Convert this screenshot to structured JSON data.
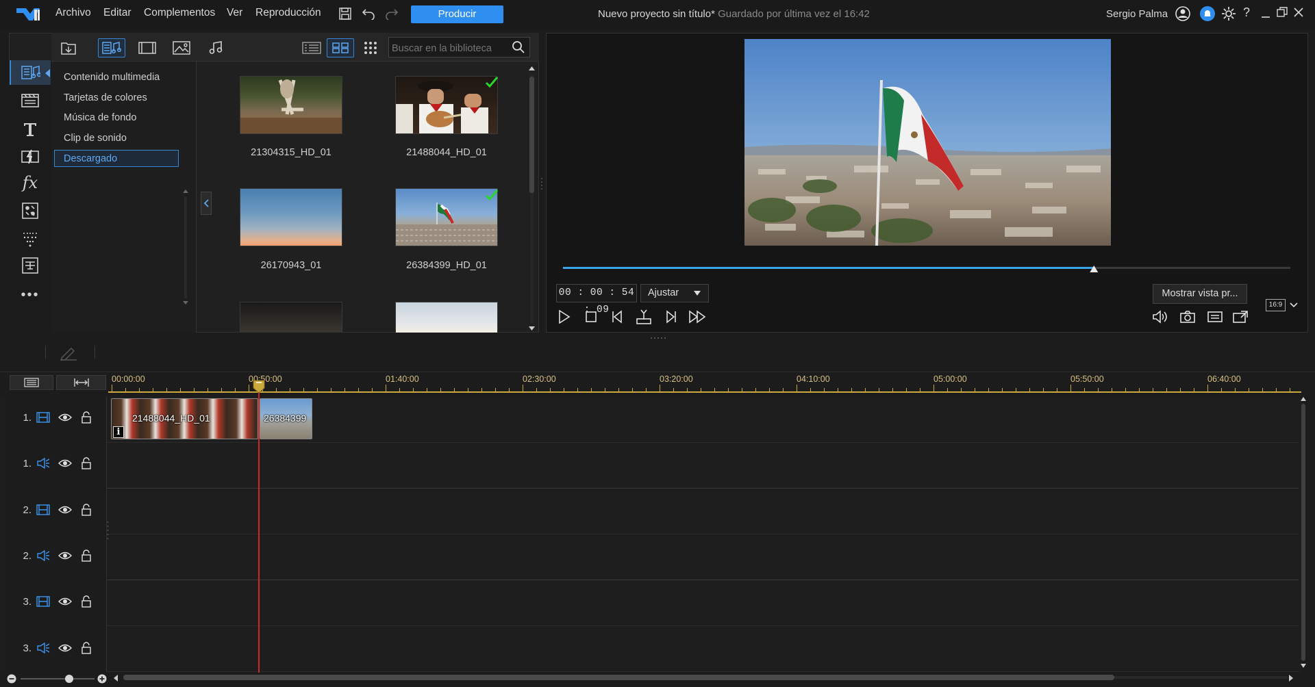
{
  "menu": {
    "items": [
      "Archivo",
      "Editar",
      "Complementos",
      "Ver",
      "Reproducción"
    ]
  },
  "produce_label": "Producir",
  "project": {
    "title": "Nuevo proyecto sin título*",
    "saved": " Guardado por última vez el 16:42"
  },
  "user": {
    "name": "Sergio Palma"
  },
  "library": {
    "search_placeholder": "Buscar en la biblioteca",
    "categories": [
      "Contenido multimedia",
      "Tarjetas de colores",
      "Música de fondo",
      "Clip de sonido",
      "Descargado"
    ],
    "selected_category": "Descargado",
    "items": [
      {
        "name": "21304315_HD_01",
        "checked": false
      },
      {
        "name": "21488044_HD_01",
        "checked": true
      },
      {
        "name": "26170943_01",
        "checked": false
      },
      {
        "name": "26384399_HD_01",
        "checked": true
      }
    ]
  },
  "preview": {
    "timecode": "00 : 00 : 54 : 09",
    "fit": "Ajustar",
    "show_preview_label": "Mostrar vista pr...",
    "aspect": "16:9",
    "progress": 0.73
  },
  "timeline": {
    "ruler_labels": [
      "00:00:00",
      "00:50:00",
      "01:40:00",
      "02:30:00",
      "03:20:00",
      "04:10:00",
      "05:00:00",
      "05:50:00",
      "06:40:00"
    ],
    "tracks": [
      {
        "num": "1.",
        "kind": "video"
      },
      {
        "num": "1.",
        "kind": "audio"
      },
      {
        "num": "2.",
        "kind": "video"
      },
      {
        "num": "2.",
        "kind": "audio"
      },
      {
        "num": "3.",
        "kind": "video"
      },
      {
        "num": "3.",
        "kind": "audio"
      }
    ],
    "clips": [
      {
        "name": "21488044_HD_01"
      },
      {
        "name": "26384399"
      }
    ]
  },
  "colors": {
    "accent": "#2f8ff0",
    "playhead": "#c72a2a",
    "ruler": "#c9a93a"
  }
}
